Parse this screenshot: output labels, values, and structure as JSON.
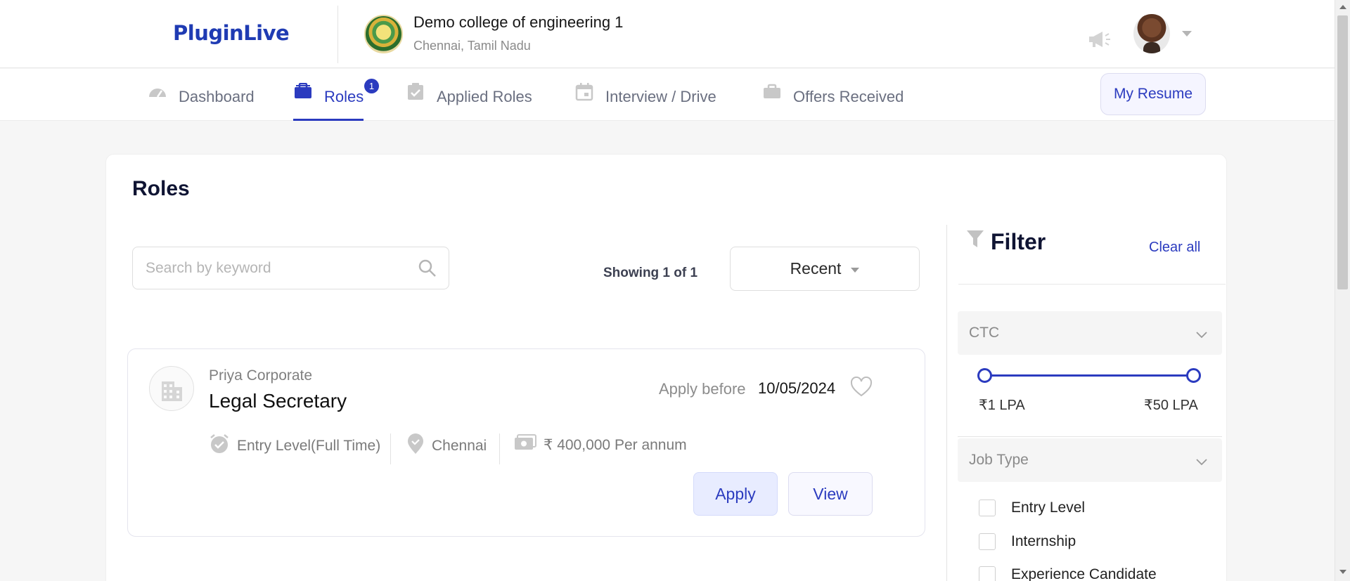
{
  "brand": {
    "logo_text": "PluginLive"
  },
  "college": {
    "name": "Demo college of engineering 1",
    "location": "Chennai, Tamil Nadu"
  },
  "nav": {
    "items": [
      {
        "label": "Dashboard",
        "icon": "speedometer-icon",
        "active": false
      },
      {
        "label": "Roles",
        "icon": "briefcase-icon",
        "active": true,
        "badge": "1"
      },
      {
        "label": "Applied Roles",
        "icon": "clipboard-check-icon",
        "active": false
      },
      {
        "label": "Interview / Drive",
        "icon": "calendar-icon",
        "active": false
      },
      {
        "label": "Offers Received",
        "icon": "suitcase-icon",
        "active": false
      }
    ],
    "resume_button": "My Resume"
  },
  "page": {
    "title": "Roles"
  },
  "search": {
    "placeholder": "Search by keyword",
    "value": ""
  },
  "results": {
    "showing": "Showing 1 of 1",
    "sort_value": "Recent"
  },
  "roles": [
    {
      "company": "Priya Corporate",
      "title": "Legal Secretary",
      "apply_before_label": "Apply before",
      "apply_before_date": "10/05/2024",
      "level": "Entry Level(Full Time)",
      "location": "Chennai",
      "salary": "₹ 400,000 Per annum",
      "apply_label": "Apply",
      "view_label": "View"
    }
  ],
  "filter": {
    "title": "Filter",
    "clear_all": "Clear all",
    "ctc": {
      "label": "CTC",
      "min_label": "₹1 LPA",
      "max_label": "₹50 LPA"
    },
    "job_type": {
      "label": "Job Type",
      "options": [
        {
          "label": "Entry Level",
          "checked": false
        },
        {
          "label": "Internship",
          "checked": false
        },
        {
          "label": "Experience Candidate",
          "checked": false
        }
      ]
    }
  },
  "colors": {
    "accent": "#2b3bbf",
    "muted_text": "#8a8a8a",
    "background": "#f6f6f6"
  }
}
